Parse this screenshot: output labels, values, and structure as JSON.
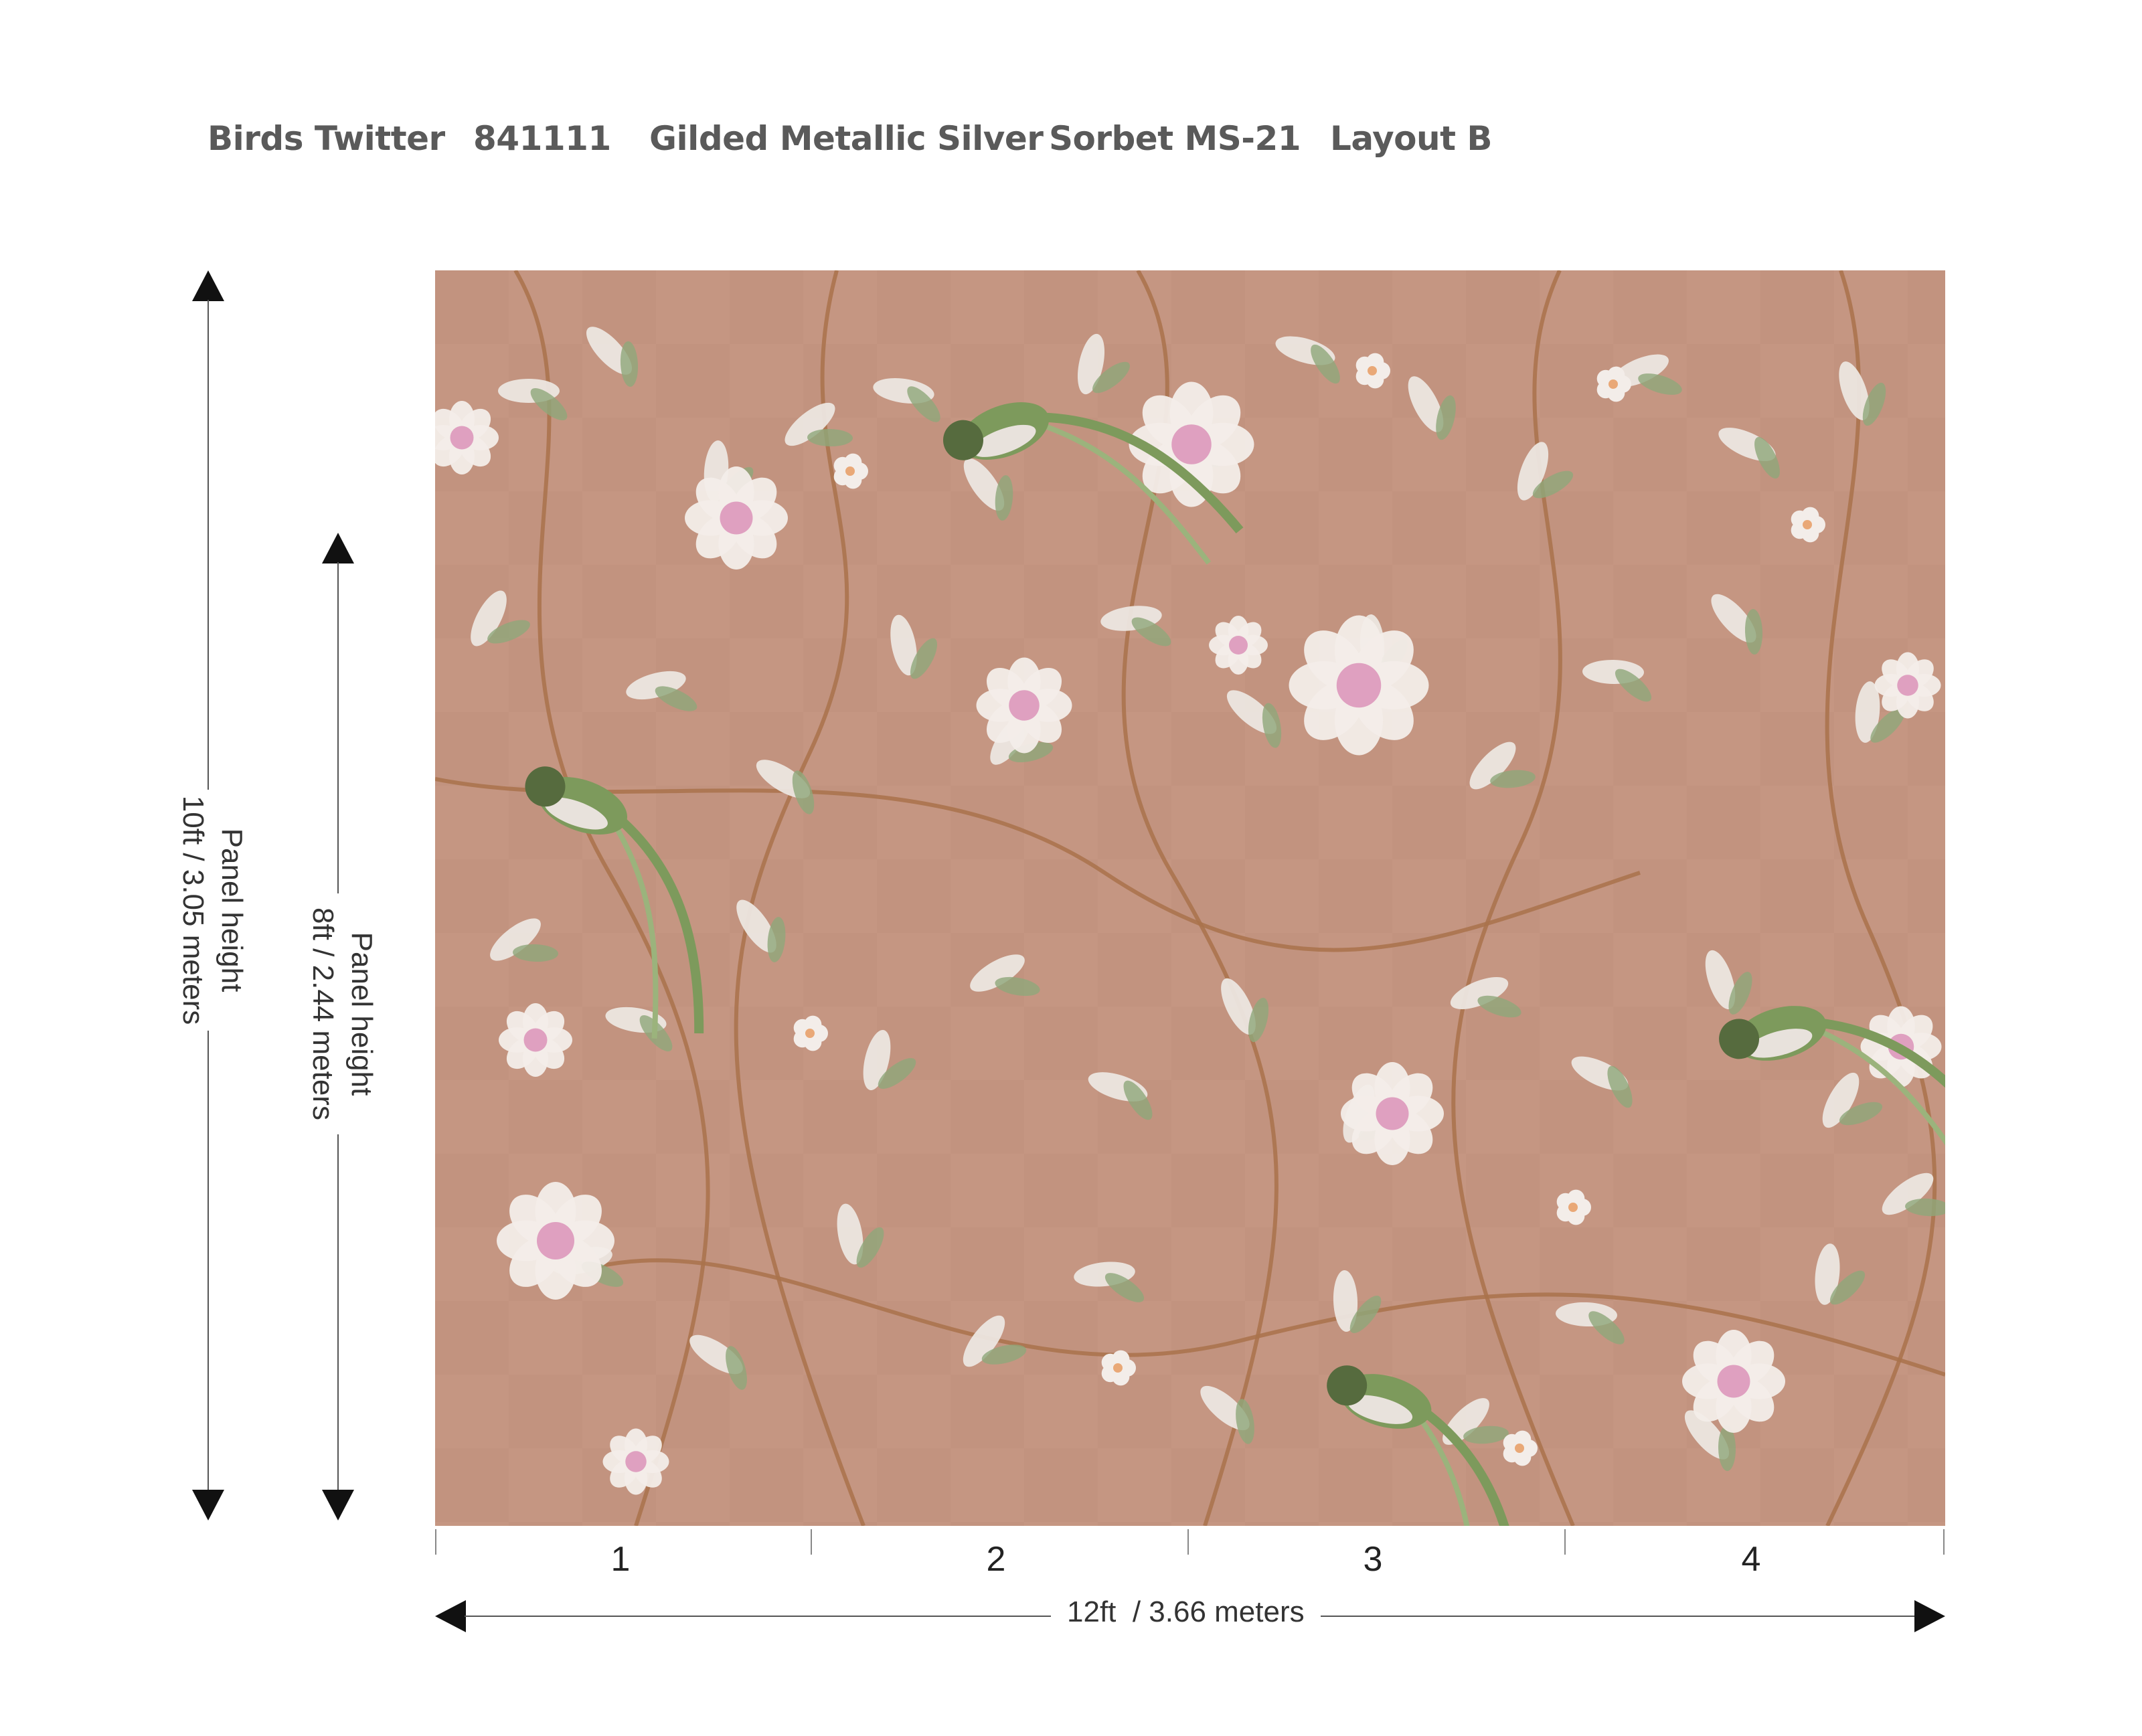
{
  "header": {
    "items": [
      "Birds Twitter",
      "841111",
      "Gilded Metallic Silver",
      "Sorbet MS-21",
      "Layout B"
    ]
  },
  "dimensions": {
    "outer_height_label": "Panel height",
    "outer_height_value": "10ft / 3.05 meters",
    "inner_height_label": "Panel height",
    "inner_height_value": "8ft / 2.44 meters",
    "width_value": "12ft  / 3.66 meters"
  },
  "panels": [
    "1",
    "2",
    "3",
    "4"
  ],
  "colors": {
    "background": "#c59682",
    "leaf": "#ece6e0",
    "leaf_green": "#8fa77a",
    "flower": "#f3ede9",
    "flower_center": "#d98cb5",
    "branch": "#a9724b",
    "bird_body": "#7d9a5c",
    "header_text": "#5a5a5a"
  }
}
